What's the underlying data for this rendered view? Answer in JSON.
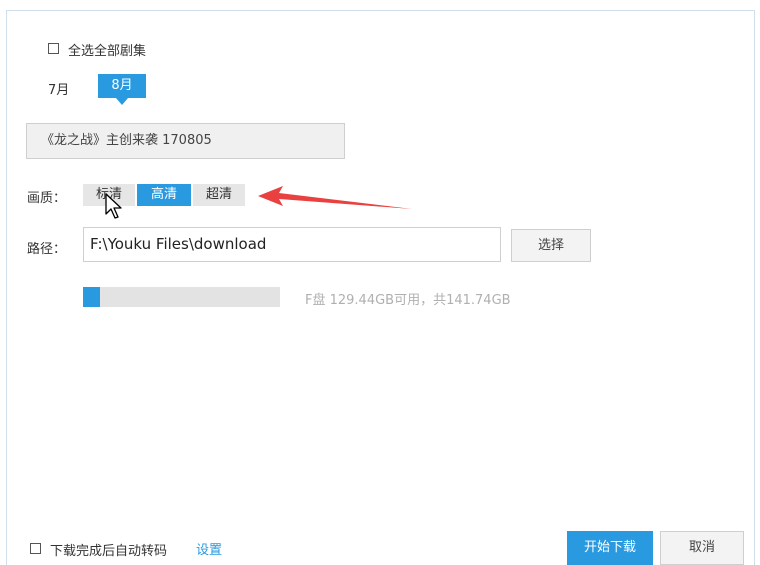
{
  "select_all": {
    "label": "全选全部剧集",
    "checked": false
  },
  "months": [
    {
      "label": "7月",
      "selected": false
    },
    {
      "label": "8月",
      "selected": true
    }
  ],
  "episode": {
    "label": "《龙之战》主创来袭 170805"
  },
  "quality": {
    "label": "画质：",
    "options": [
      {
        "label": "标清",
        "selected": false
      },
      {
        "label": "高清",
        "selected": true
      },
      {
        "label": "超清",
        "selected": false
      }
    ]
  },
  "path": {
    "label": "路径：",
    "value": "F:\\Youku Files\\download",
    "choose_label": "选择"
  },
  "disk": {
    "info": "F盘 129.44GB可用，共141.74GB",
    "used_fraction": 0.087
  },
  "footer": {
    "auto_transcode_label": "下载完成后自动转码",
    "auto_transcode_checked": false,
    "settings_link": "设置",
    "start_label": "开始下载",
    "cancel_label": "取消"
  },
  "colors": {
    "accent": "#2a9ae0",
    "annotation_arrow": "#e8413f"
  },
  "icons": [
    "mouse-cursor-icon",
    "annotation-arrow-icon"
  ]
}
